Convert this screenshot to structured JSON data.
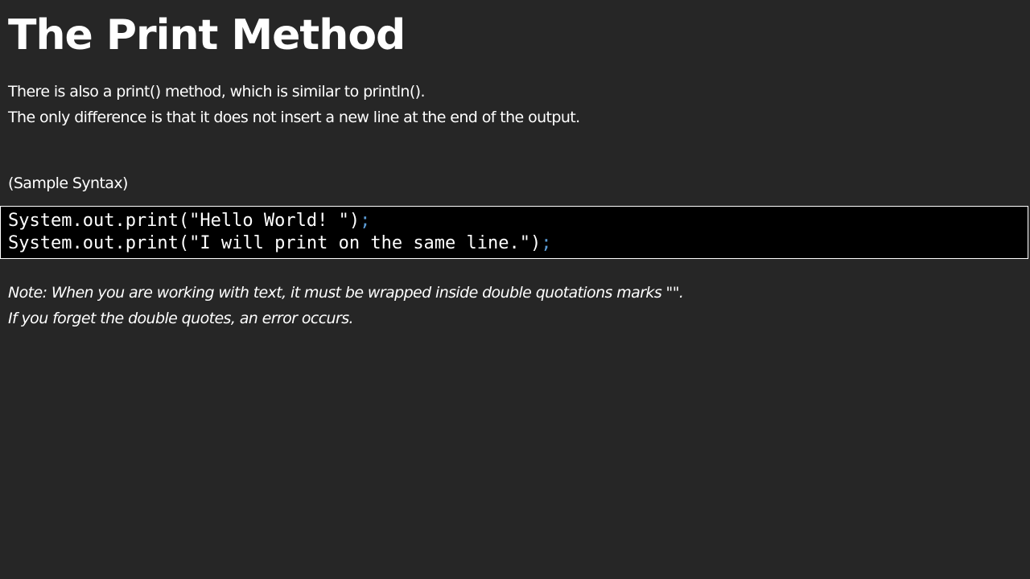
{
  "title": "The Print Method",
  "intro": {
    "line1": "There is also a print() method, which is similar to println().",
    "line2": "The only difference is that it does not insert a new line at the end of the output."
  },
  "syntax_label": "(Sample Syntax)",
  "code": {
    "line1": "System.out.print(\"Hello World! \")",
    "line2": "System.out.print(\"I will print on the same line.\")",
    "terminator": ";",
    "terminator_color": "#5b9bd5"
  },
  "note": {
    "line1": "Note: When you are working with text, it must be wrapped inside double quotations marks \"\".",
    "line2": "If you forget the double quotes, an error occurs."
  },
  "colors": {
    "background": "#262626",
    "code_background": "#000000",
    "text": "#ffffff"
  }
}
